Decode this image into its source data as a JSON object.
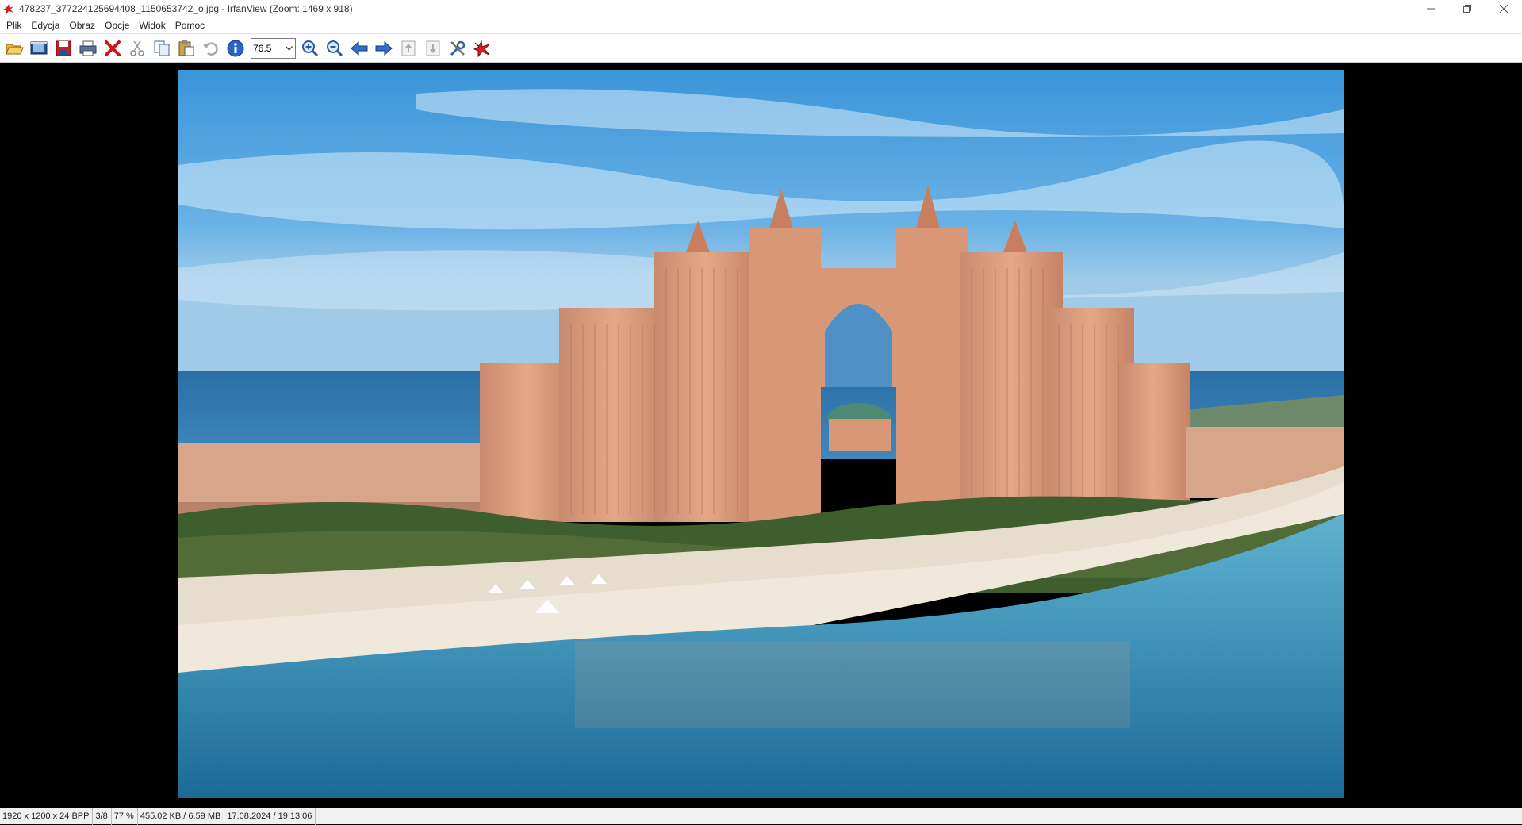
{
  "window": {
    "title": "478237_377224125694408_1150653742_o.jpg - IrfanView (Zoom: 1469 x 918)",
    "icon": "irfanview-app-icon"
  },
  "menu": {
    "items": [
      {
        "label": "Plik"
      },
      {
        "label": "Edycja"
      },
      {
        "label": "Obraz"
      },
      {
        "label": "Opcje"
      },
      {
        "label": "Widok"
      },
      {
        "label": "Pomoc"
      }
    ]
  },
  "toolbar": {
    "buttons": [
      {
        "icon": "open-folder-icon"
      },
      {
        "icon": "slideshow-icon"
      },
      {
        "icon": "save-icon"
      },
      {
        "icon": "print-icon"
      },
      {
        "icon": "delete-icon"
      },
      {
        "icon": "cut-icon"
      },
      {
        "icon": "copy-icon"
      },
      {
        "icon": "paste-icon"
      },
      {
        "icon": "undo-icon"
      },
      {
        "icon": "info-icon"
      }
    ],
    "zoom_value": "76.5",
    "buttons_after": [
      {
        "icon": "zoom-in-icon"
      },
      {
        "icon": "zoom-out-icon"
      },
      {
        "icon": "previous-icon"
      },
      {
        "icon": "next-icon"
      },
      {
        "icon": "first-page-icon"
      },
      {
        "icon": "last-page-icon"
      },
      {
        "icon": "settings-icon"
      },
      {
        "icon": "irfanview-logo-icon"
      }
    ]
  },
  "image": {
    "description_icon": "photo-atlantis-palm-hotel"
  },
  "status": {
    "dimensions": "1920 x 1200 x 24 BPP",
    "index": "3/8",
    "zoom": "77 %",
    "size": "455.02 KB / 6.59 MB",
    "datetime": "17.08.2024 / 19:13:06"
  },
  "colors": {
    "sky_top": "#2f8fd6",
    "sky_bottom": "#b9dcf2",
    "sea": "#1f6fa8",
    "sand": "#e9e1d1",
    "hotel": "#d9987a"
  }
}
